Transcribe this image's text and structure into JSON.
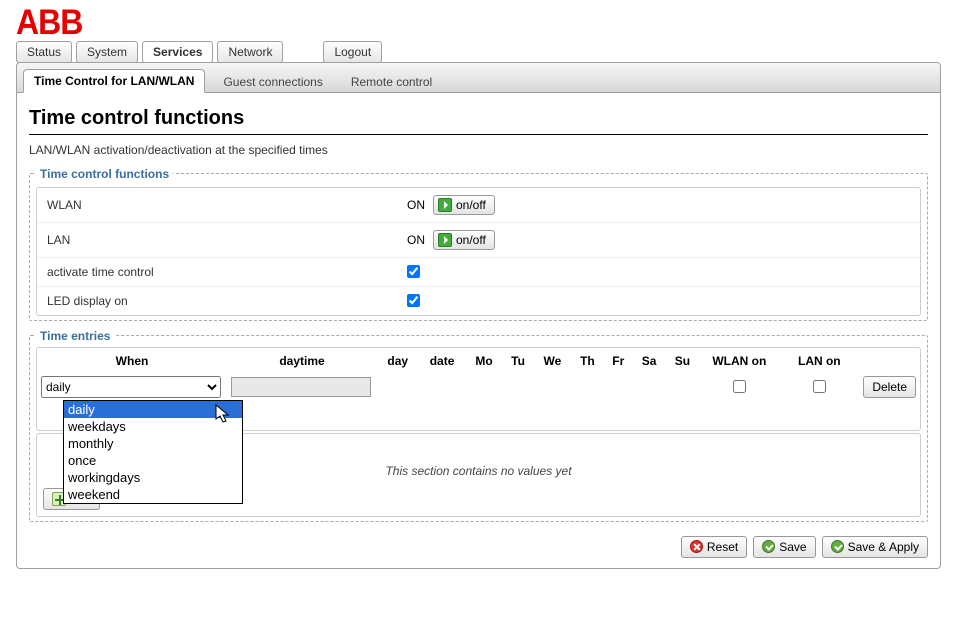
{
  "logo_text": "ABB",
  "main_tabs": {
    "status": "Status",
    "system": "System",
    "services": "Services",
    "network": "Network",
    "logout": "Logout"
  },
  "sub_tabs": {
    "time_control": "Time Control for LAN/WLAN",
    "guest": "Guest connections",
    "remote": "Remote control"
  },
  "page_title": "Time control functions",
  "page_desc": "LAN/WLAN activation/deactivation at the specified times",
  "legend_functions": "Time control functions",
  "rows": {
    "wlan_label": "WLAN",
    "wlan_on": "ON",
    "wlan_toggle": "on/off",
    "lan_label": "LAN",
    "lan_on": "ON",
    "lan_toggle": "on/off",
    "activate_label": "activate time control",
    "led_label": "LED display on"
  },
  "legend_entries": "Time entries",
  "headers": {
    "when": "When",
    "daytime": "daytime",
    "day": "day",
    "date": "date",
    "mo": "Mo",
    "tu": "Tu",
    "we": "We",
    "th": "Th",
    "fr": "Fr",
    "sa": "Sa",
    "su": "Su",
    "wlan_on": "WLAN on",
    "lan_on": "LAN on"
  },
  "when_selected": "daily",
  "dropdown": {
    "daily": "daily",
    "weekdays": "weekdays",
    "monthly": "monthly",
    "once": "once",
    "workingdays": "workingdays",
    "weekend": "weekend"
  },
  "delete_btn": "Delete",
  "empty_msg": "This section contains no values yet",
  "add_btn": "Add",
  "footer": {
    "reset": "Reset",
    "save": "Save",
    "save_apply": "Save & Apply"
  }
}
